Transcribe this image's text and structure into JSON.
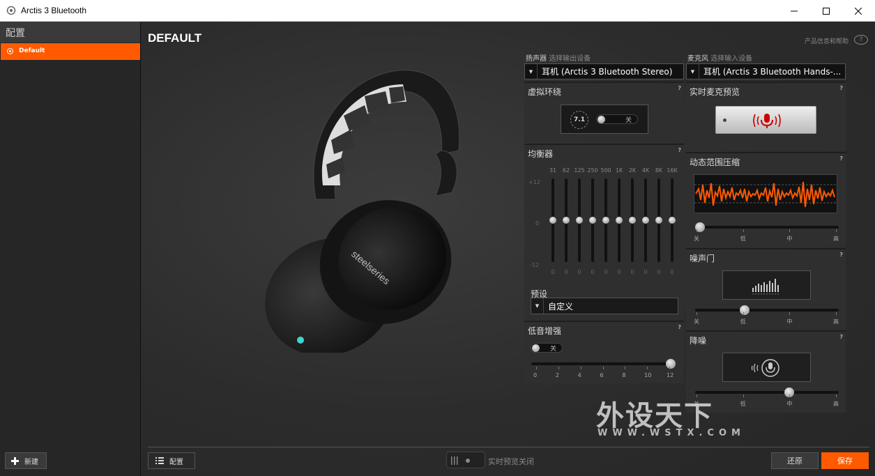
{
  "window": {
    "title": "Arctis 3 Bluetooth",
    "minimize": "—",
    "maximize": "☐",
    "close": "✕"
  },
  "sidebar": {
    "header": "配置",
    "items": [
      {
        "label": "Default",
        "selected": true
      }
    ],
    "new_button": "新建"
  },
  "main": {
    "title": "DEFAULT",
    "help_link": "产品信息和帮助",
    "help_icon": "?"
  },
  "output": {
    "label": "扬声器",
    "sub": "选择输出设备",
    "device": "耳机 (Arctis 3 Bluetooth Stereo)"
  },
  "input": {
    "label": "麦克风",
    "sub": "选择输入设备",
    "device": "耳机 (Arctis 3 Bluetooth Hands-..."
  },
  "virtual_surround": {
    "title": "虚拟环绕",
    "badge": "7.1",
    "toggle_label": "关",
    "enabled": false,
    "help": "?"
  },
  "equalizer": {
    "title": "均衡器",
    "help": "?",
    "scale_top": "+12",
    "scale_mid": "0",
    "scale_bottom": "-12",
    "bands": [
      {
        "freq": "31",
        "value": "0"
      },
      {
        "freq": "62",
        "value": "0"
      },
      {
        "freq": "125",
        "value": "0"
      },
      {
        "freq": "250",
        "value": "0"
      },
      {
        "freq": "500",
        "value": "0"
      },
      {
        "freq": "1K",
        "value": "0"
      },
      {
        "freq": "2K",
        "value": "0"
      },
      {
        "freq": "4K",
        "value": "0"
      },
      {
        "freq": "8K",
        "value": "0"
      },
      {
        "freq": "16K",
        "value": "0"
      }
    ],
    "preset_label": "预设",
    "preset_value": "自定义"
  },
  "bass_boost": {
    "title": "低音增强",
    "help": "?",
    "toggle_label": "关",
    "enabled": false,
    "ticks": [
      "0",
      "2",
      "4",
      "6",
      "8",
      "10",
      "12"
    ],
    "value": 12
  },
  "mic_preview": {
    "title": "实时麦克预览",
    "help": "?",
    "icon": "microphone-icon"
  },
  "dynamic_range": {
    "title": "动态范围压缩",
    "help": "?",
    "ticks": [
      "关",
      "低",
      "中",
      "高"
    ],
    "level": "关"
  },
  "noise_gate": {
    "title": "噪声门",
    "help": "?",
    "ticks": [
      "关",
      "低",
      "中",
      "高"
    ],
    "level": "低"
  },
  "noise_reduction": {
    "title": "降噪",
    "help": "?",
    "ticks": [
      "关",
      "低",
      "中",
      "高"
    ],
    "level": "中"
  },
  "footer": {
    "config_button": "配置",
    "preview_label": "实时预览关闭",
    "restore_button": "还原",
    "save_button": "保存"
  },
  "watermark": {
    "text": "外设天下",
    "url": "WWW.WSTX.COM"
  },
  "colors": {
    "accent": "#ff5a00",
    "background": "#2a2a2a",
    "waveform": "#ff5a00"
  }
}
